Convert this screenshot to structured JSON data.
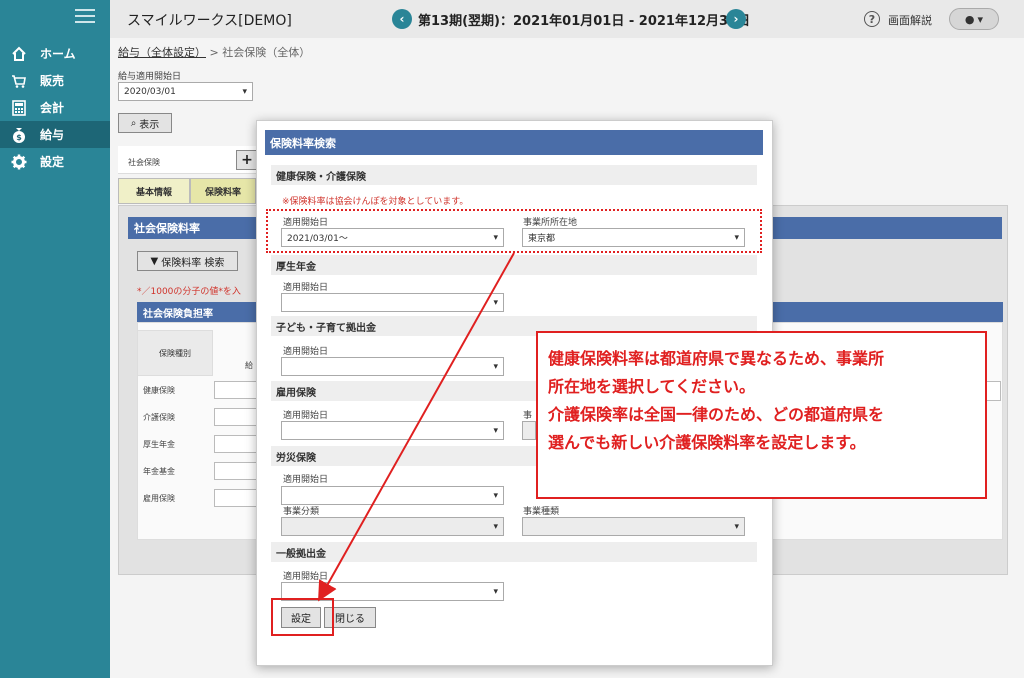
{
  "app": {
    "name": "スマイルワークス[DEMO]"
  },
  "header": {
    "period": "第13期(翌期)：2021年01月01日 - 2021年12月31日",
    "help_label": "画面解説",
    "prev_icon": "chevron-left-icon",
    "next_icon": "chevron-right-icon"
  },
  "sidebar": {
    "items": [
      {
        "label": "ホーム",
        "icon": "home-icon"
      },
      {
        "label": "販売",
        "icon": "cart-icon"
      },
      {
        "label": "会計",
        "icon": "calculator-icon"
      },
      {
        "label": "給与",
        "icon": "moneybag-icon"
      },
      {
        "label": "設定",
        "icon": "gear-icon"
      }
    ]
  },
  "breadcrumb": {
    "parent": "給与（全体設定）",
    "sep": ">",
    "current": "社会保険（全体）"
  },
  "background": {
    "start_label": "給与適用開始日",
    "start_value": "2020/03/01",
    "show_button": "表示",
    "social_label": "社会保険",
    "add_button": "+",
    "tabs": [
      "基本情報",
      "保険料率"
    ],
    "section_title": "社会保険料率",
    "search_button": "保険料率 検索",
    "note": "*／1000の分子の値*を入",
    "burden_title": "社会保険負担率",
    "col_type": "保険種別",
    "col_sub": "給",
    "rows": [
      "健康保険",
      "介護保険",
      "厚生年金",
      "年金基金",
      "雇用保険"
    ]
  },
  "modal": {
    "title": "保険料率検索",
    "health": {
      "title": "健康保険・介護保険",
      "note": "※保険料率は協会けんぽを対象としています。",
      "date_label": "適用開始日",
      "date_value": "2021/03/01～",
      "pref_label": "事業所所在地",
      "pref_value": "東京都"
    },
    "pension": {
      "title": "厚生年金",
      "date_label": "適用開始日",
      "date_value": ""
    },
    "child": {
      "title": "子ども・子育て拠出金",
      "date_label": "適用開始日",
      "date_value": ""
    },
    "employment": {
      "title": "雇用保険",
      "date_label": "適用開始日",
      "date_value": "",
      "extra_label": "事"
    },
    "accident": {
      "title": "労災保険",
      "date_label": "適用開始日",
      "date_value": "",
      "biz_cat_label": "事業分類",
      "biz_type_label": "事業種類"
    },
    "general": {
      "title": "一般拠出金",
      "date_label": "適用開始日",
      "date_value": ""
    },
    "set_button": "設定",
    "close_button": "閉じる"
  },
  "callout": {
    "lines": [
      "健康保険料率は都道府県で異なるため、事業所",
      "所在地を選択してください。",
      "介護保険率は全国一律のため、どの都道府県を",
      "選んでも新しい介護保険料率を設定します。"
    ]
  },
  "colors": {
    "sidebar": "#2a8597",
    "header_blue": "#4a6da8",
    "accent_red": "#e02020"
  }
}
